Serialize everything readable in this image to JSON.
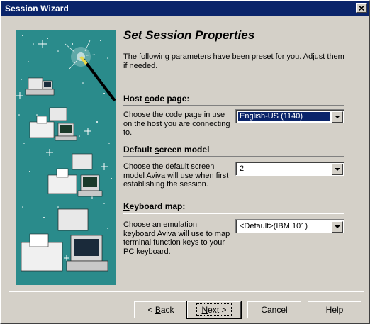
{
  "window": {
    "title": "Session Wizard"
  },
  "page": {
    "heading": "Set Session Properties",
    "intro": "The following parameters have been preset for you. Adjust them if needed."
  },
  "sections": {
    "host_code_page": {
      "label_pre": "Host ",
      "label_ul": "c",
      "label_post": "ode page:",
      "description": "Choose the code page in use on the host you are connecting to.",
      "value": "English-US (1140)"
    },
    "screen_model": {
      "label_pre": "Default ",
      "label_ul": "s",
      "label_post": "creen model",
      "description": "Choose the default screen model Aviva will use when first establishing the session.",
      "value": "2"
    },
    "keyboard_map": {
      "label_pre": "",
      "label_ul": "K",
      "label_post": "eyboard map:",
      "description": "Choose an emulation keyboard Aviva will use to map terminal function keys to your PC keyboard.",
      "value": "<Default>(IBM 101)"
    }
  },
  "buttons": {
    "back": {
      "prefix": "< ",
      "ul": "B",
      "rest": "ack"
    },
    "next": {
      "ul": "N",
      "rest": "ext >"
    },
    "cancel": "Cancel",
    "help": "Help"
  },
  "colors": {
    "titlebar": "#0a246a",
    "panel": "#2a8b8b",
    "face": "#d4d0c8"
  },
  "icons": [
    "close-icon",
    "magic-wand-icon",
    "computer-icon",
    "printer-icon",
    "dropdown-arrow-icon"
  ]
}
